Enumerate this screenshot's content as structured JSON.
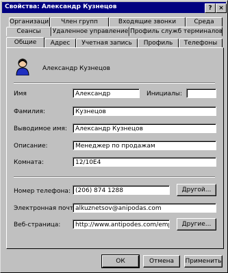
{
  "window": {
    "title": "Свойства: Александр Кузнецов",
    "help_label": "?",
    "close_label": "×"
  },
  "tabs": {
    "row1": [
      "Организация",
      "Член групп",
      "Входящие звонки",
      "Среда"
    ],
    "row2": [
      "Сеансы",
      "Удаленное управление",
      "Профиль служб терминалов"
    ],
    "row3": [
      "Общие",
      "Адрес",
      "Учетная запись",
      "Профиль",
      "Телефоны"
    ],
    "active": "Общие"
  },
  "general": {
    "display_header": "Александр Кузнецов",
    "first_name_label": "Имя",
    "first_name": "Александр",
    "initials_label": "Инициалы:",
    "initials": "",
    "last_name_label": "Фамилия:",
    "last_name": "Кузнецов",
    "display_name_label": "Выводимое имя:",
    "display_name": "Александр Кузнецов",
    "description_label": "Описание:",
    "description": "Менеджер по продажам",
    "office_label": "Комната:",
    "office": "12/10Е4",
    "phone_label": "Номер телефона:",
    "phone": "(206) 874 1288",
    "phone_other_button": "Другой...",
    "email_label": "Электронная почта:",
    "email": "alkuznetsov@anipodas.com",
    "web_label": "Веб-страница:",
    "web": "http://www.antipodes.com/emplo",
    "web_other_button": "Другие..."
  },
  "buttons": {
    "ok": "ОК",
    "cancel": "Отмена",
    "apply": "Применить"
  }
}
